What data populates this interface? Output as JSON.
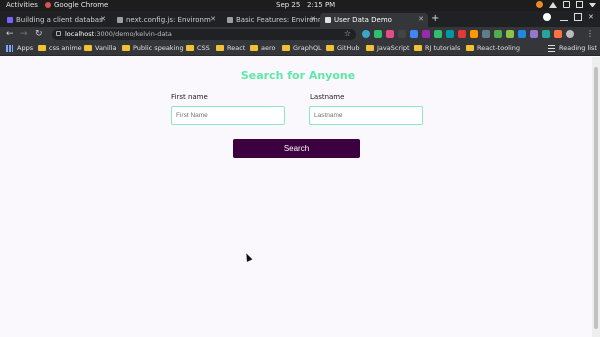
{
  "system_bar": {
    "activities": "Activities",
    "app_name": "Google Chrome",
    "date": "Sep 25",
    "time": "2:15 PM"
  },
  "tabs": [
    {
      "label": "Building a client databas",
      "icon": "page-icon",
      "color": "#7b61ff",
      "active": false
    },
    {
      "label": "next.config.js: Environm",
      "icon": "next-icon",
      "color": "#9e9e9e",
      "active": false
    },
    {
      "label": "Basic Features: Environm",
      "icon": "next-icon",
      "color": "#9e9e9e",
      "active": false
    },
    {
      "label": "User Data Demo",
      "icon": "page-icon",
      "color": "#e0e0e0",
      "active": true
    }
  ],
  "toolbar": {
    "url_host": "localhost",
    "url_path": ":3000/demo/kelvin-data"
  },
  "bookmarks": [
    {
      "label": "Apps",
      "icon": "apps-grid-icon"
    },
    {
      "label": "css anime",
      "icon": "folder-icon"
    },
    {
      "label": "Vanilla",
      "icon": "folder-icon"
    },
    {
      "label": "Public speaking",
      "icon": "folder-icon"
    },
    {
      "label": "CSS",
      "icon": "folder-icon"
    },
    {
      "label": "React",
      "icon": "folder-icon"
    },
    {
      "label": "aero",
      "icon": "folder-icon"
    },
    {
      "label": "GraphQL",
      "icon": "folder-icon"
    },
    {
      "label": "GitHub",
      "icon": "folder-icon"
    },
    {
      "label": "JavaScript",
      "icon": "folder-icon"
    },
    {
      "label": "RJ tutorials",
      "icon": "folder-icon"
    },
    {
      "label": "React-tooling",
      "icon": "folder-icon"
    },
    {
      "label": "Reading list",
      "icon": "reading-list-icon"
    }
  ],
  "page": {
    "heading": "Search for Anyone",
    "first_name_label": "First name",
    "first_name_placeholder": "First Name",
    "last_name_label": "Lastname",
    "last_name_placeholder": "Lastname",
    "search_button": "Search"
  },
  "colors": {
    "heading": "#5ee8a9",
    "input_border": "#8ee6c4",
    "button_bg": "#3c0041"
  }
}
